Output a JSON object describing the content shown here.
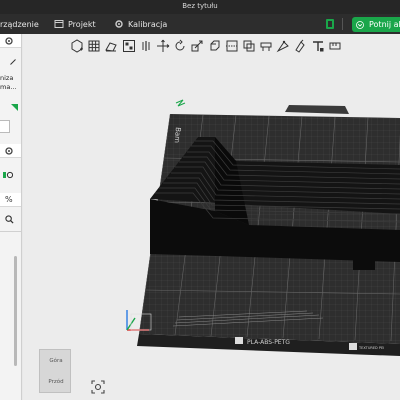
{
  "window": {
    "title": "Bez tytułu"
  },
  "navbar": {
    "devices_label": "rządzenie",
    "project_label": "Projekt",
    "calibration_label": "Kalibracja",
    "slice_label": "Potnij ak",
    "accent_color": "#1aa64a"
  },
  "sidebar": {
    "text_line1": "niza",
    "text_line2": "ma..."
  },
  "bed": {
    "edge_label": "Bam",
    "plate_label": "PLA-ABS-PETG",
    "brand_label": "TEXTURED PEI"
  },
  "navcube": {
    "top_face": "Góra",
    "front_face": "Przód"
  },
  "icons": [
    "tab-devices-icon",
    "project-icon",
    "calibration-icon",
    "cube-icon",
    "add-object-icon",
    "add-plate-icon",
    "orient-icon",
    "arrange-icon",
    "split-icon",
    "move-icon",
    "rotate-icon",
    "scale-icon",
    "cut-icon",
    "support-icon",
    "seam-icon",
    "text-icon",
    "fit-view-icon"
  ]
}
